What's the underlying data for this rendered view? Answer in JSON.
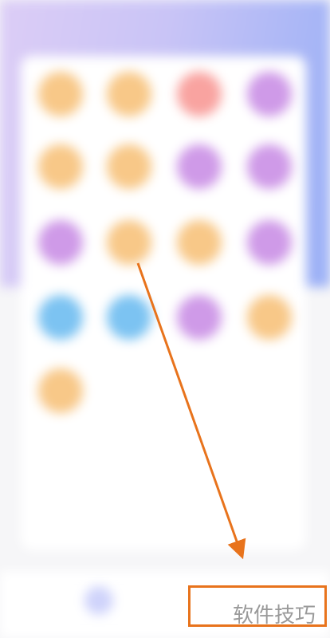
{
  "header": {
    "title": "",
    "gradient_colors": [
      "#dccdf6",
      "#c9c4f6",
      "#9ab0f6"
    ]
  },
  "grid": {
    "icons": [
      {
        "color": "#f8c888",
        "name": "app-icon-orange"
      },
      {
        "color": "#f8c888",
        "name": "app-icon-orange"
      },
      {
        "color": "#f9a3a0",
        "name": "app-icon-red"
      },
      {
        "color": "#cf9ae8",
        "name": "app-icon-purple"
      },
      {
        "color": "#f8c888",
        "name": "app-icon-orange"
      },
      {
        "color": "#f8c888",
        "name": "app-icon-orange"
      },
      {
        "color": "#cf9ae8",
        "name": "app-icon-purple"
      },
      {
        "color": "#cf9ae8",
        "name": "app-icon-purple"
      },
      {
        "color": "#cf9ae8",
        "name": "app-icon-purple"
      },
      {
        "color": "#f8c888",
        "name": "app-icon-orange"
      },
      {
        "color": "#f8c888",
        "name": "app-icon-orange"
      },
      {
        "color": "#cf9ae8",
        "name": "app-icon-purple"
      },
      {
        "color": "#7cc3f2",
        "name": "app-icon-blue"
      },
      {
        "color": "#7cc3f2",
        "name": "app-icon-blue"
      },
      {
        "color": "#cf9ae8",
        "name": "app-icon-purple"
      },
      {
        "color": "#f8c888",
        "name": "app-icon-orange"
      },
      {
        "color": "#f8c888",
        "name": "app-icon-orange"
      }
    ]
  },
  "annotation": {
    "arrow_color": "#e8731c",
    "box_color": "#e8731c"
  },
  "watermark": {
    "text": "软件技巧"
  }
}
